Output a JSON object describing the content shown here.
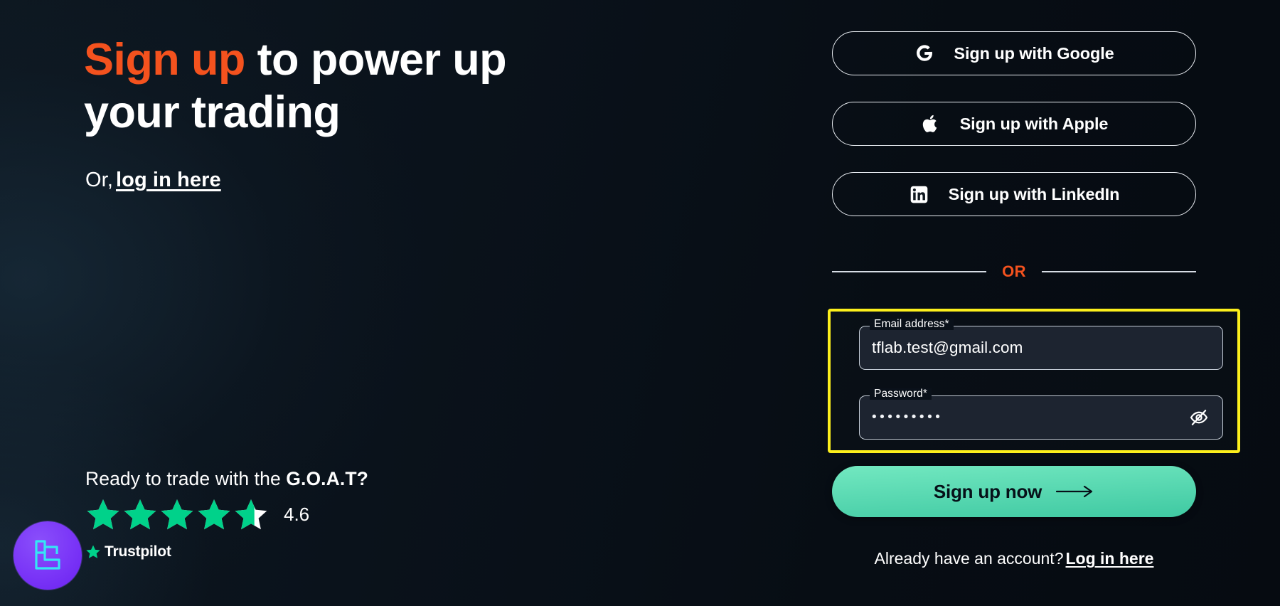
{
  "brand": {
    "badge_icon": "brand-logo-icon",
    "badge_color": "#7a35f7",
    "accent_color": "#f4521e",
    "cta_color": "#5fdcb5",
    "highlight_color": "#fcef1c"
  },
  "hero": {
    "headline_accent": "Sign up",
    "headline_rest": " to power up your trading",
    "or_prefix": "Or,",
    "login_link": "log in here"
  },
  "trustpilot": {
    "prompt_prefix": "Ready to trade with the ",
    "prompt_bold": "G.O.A.T?",
    "rating": "4.6",
    "rating_value": 4.6,
    "stars_total": 5,
    "star_color": "#00d28a",
    "logo_label": "Trustpilot",
    "logo_star_icon": "trustpilot-star-icon"
  },
  "social_buttons": [
    {
      "label": "Sign up with Google",
      "icon": "google-icon"
    },
    {
      "label": "Sign up with Apple",
      "icon": "apple-icon"
    },
    {
      "label": "Sign up with LinkedIn",
      "icon": "linkedin-icon"
    }
  ],
  "divider": {
    "text": "OR"
  },
  "form": {
    "email": {
      "label": "Email address*",
      "value": "tflab.test@gmail.com",
      "placeholder": "Email address*"
    },
    "password": {
      "label": "Password*",
      "value": "•••••••••",
      "placeholder": "Password*",
      "masked": true,
      "toggle_icon": "eye-off-icon"
    }
  },
  "cta": {
    "label": "Sign up now",
    "icon": "arrow-right-icon"
  },
  "footer": {
    "text": "Already have an account?",
    "link": "Log in here"
  }
}
